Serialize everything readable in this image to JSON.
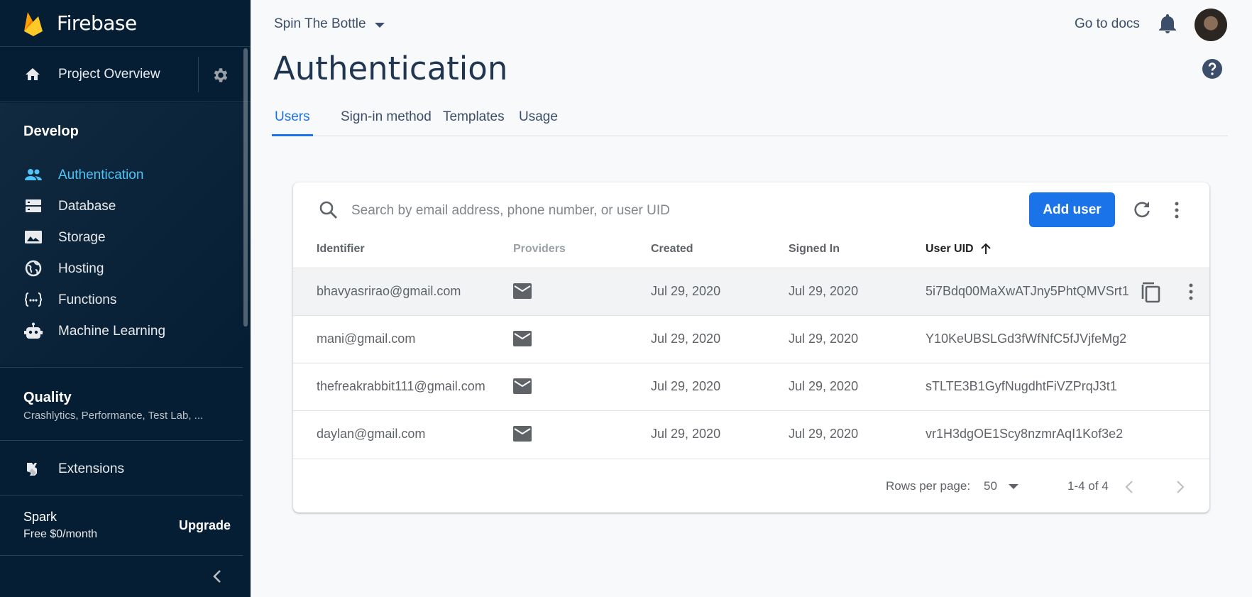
{
  "brand": {
    "name": "Firebase"
  },
  "sidebar": {
    "overview_label": "Project Overview",
    "develop_title": "Develop",
    "develop_items": [
      {
        "label": "Authentication",
        "icon": "people-icon",
        "active": true
      },
      {
        "label": "Database",
        "icon": "database-icon"
      },
      {
        "label": "Storage",
        "icon": "storage-icon"
      },
      {
        "label": "Hosting",
        "icon": "globe-icon"
      },
      {
        "label": "Functions",
        "icon": "functions-icon"
      },
      {
        "label": "Machine Learning",
        "icon": "robot-icon"
      }
    ],
    "quality_title": "Quality",
    "quality_sub": "Crashlytics, Performance, Test Lab, ...",
    "extensions_label": "Extensions",
    "plan_name": "Spark",
    "plan_price": "Free $0/month",
    "upgrade_label": "Upgrade"
  },
  "header": {
    "project_name": "Spin The Bottle",
    "docs_link": "Go to docs"
  },
  "page": {
    "title": "Authentication",
    "tabs": [
      {
        "label": "Users",
        "active": true
      },
      {
        "label": "Sign-in method"
      },
      {
        "label": "Templates"
      },
      {
        "label": "Usage"
      }
    ]
  },
  "users": {
    "search_placeholder": "Search by email address, phone number, or user UID",
    "add_user_label": "Add user",
    "columns": {
      "identifier": "Identifier",
      "providers": "Providers",
      "created": "Created",
      "signed_in": "Signed In",
      "uid": "User UID"
    },
    "rows": [
      {
        "identifier": "bhavyasrirao@gmail.com",
        "created": "Jul 29, 2020",
        "signed_in": "Jul 29, 2020",
        "uid": "5i7Bdq00MaXwATJny5PhtQMVSrt1"
      },
      {
        "identifier": "mani@gmail.com",
        "created": "Jul 29, 2020",
        "signed_in": "Jul 29, 2020",
        "uid": "Y10KeUBSLGd3fWfNfC5fJVjfeMg2"
      },
      {
        "identifier": "thefreakrabbit111@gmail.com",
        "created": "Jul 29, 2020",
        "signed_in": "Jul 29, 2020",
        "uid": "sTLTE3B1GyfNugdhtFiVZPrqJ3t1"
      },
      {
        "identifier": "daylan@gmail.com",
        "created": "Jul 29, 2020",
        "signed_in": "Jul 29, 2020",
        "uid": "vr1H3dgOE1Scy8nzmrAqI1Kof3e2"
      }
    ],
    "rows_per_page_label": "Rows per page:",
    "rows_per_page_value": "50",
    "range_label": "1-4 of 4"
  },
  "colors": {
    "sidebar_bg": "#051e34",
    "accent": "#1a73e8",
    "active_nav": "#4fc3f7"
  }
}
